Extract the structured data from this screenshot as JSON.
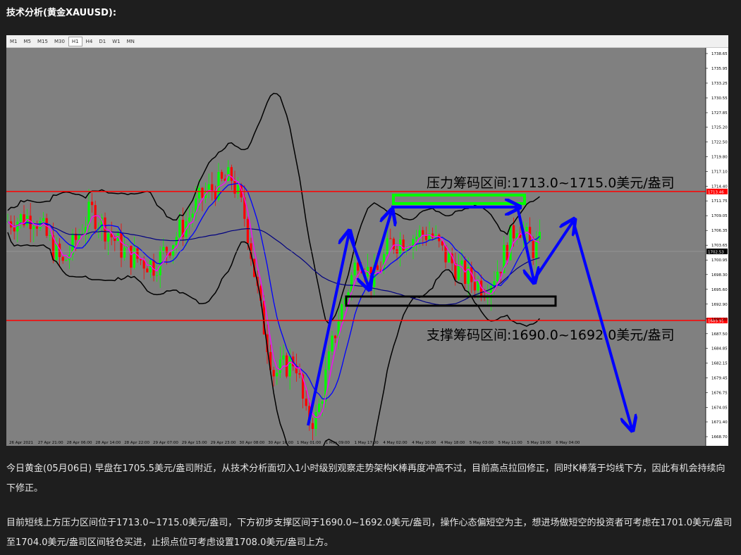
{
  "heading": "技术分析(黄金XAUUSD):",
  "toolbar": {
    "timeframes": [
      "M1",
      "M5",
      "M15",
      "M30",
      "H1",
      "H4",
      "D1",
      "W1",
      "MN"
    ],
    "active": "H1"
  },
  "chart": {
    "price_axis": [
      "1738.65",
      "1735.95",
      "1733.25",
      "1730.55",
      "1727.85",
      "1725.20",
      "1722.50",
      "1719.80",
      "1717.10",
      "1714.40",
      "1711.75",
      "1709.05",
      "1706.35",
      "1703.65",
      "1700.95",
      "1698.30",
      "1695.60",
      "1692.90",
      "1690.20",
      "1687.50",
      "1684.85",
      "1682.15",
      "1679.45",
      "1676.75",
      "1674.05",
      "1671.40",
      "1668.70"
    ],
    "time_axis": [
      "26 Apr 2021",
      "27 Apr 21:00",
      "28 Apr 06:00",
      "28 Apr 14:00",
      "28 Apr 22:00",
      "29 Apr 07:00",
      "29 Apr 15:00",
      "29 Apr 23:00",
      "30 Apr 08:00",
      "30 Apr 16:00",
      "1 May 01:00",
      "1 May 09:00",
      "1 May 17:00",
      "4 May 02:00",
      "4 May 10:00",
      "4 May 18:00",
      "5 May 03:00",
      "5 May 11:00",
      "5 May 19:00",
      "6 May 04:00"
    ],
    "current_price_tag": "1702.53",
    "resistance_tag": "1713.46",
    "support_tag": "1689.91",
    "resistance_label": "压力筹码区间:1713.0~1715.0美元/盎司",
    "support_label": "支撑筹码区间:1690.0~1692.0美元/盎司",
    "colors": {
      "background": "#808080",
      "level_line": "#ff0000",
      "resistance_box": "#00ff00",
      "support_box": "#000000",
      "arrows": "#0000ff",
      "bull_candle": "#00ff00",
      "bear_candle": "#ff0000",
      "ma_fast": "#ff00ff",
      "ma_mid": "#0000ff",
      "ma_slow": "#000080",
      "bollinger": "#000000"
    }
  },
  "paragraphs": [
    "今日黄金(05月06日) 早盘在1705.5美元/盎司附近，从技术分析面切入1小时级别观察走势架构K棒再度冲高不过，目前高点拉回修正，同时K棒落于均线下方，因此有机会持续向下修正。",
    "目前短线上方压力区间位于1713.0~1715.0美元/盎司，下方初步支撑区间于1690.0~1692.0美元/盎司，操作心态偏短空为主，想进场做短空的投资者可考虑在1701.0美元/盎司至1704.0美元/盎司区间轻仓买进，止损点位可考虑设置1708.0美元/盎司上方。"
  ]
}
